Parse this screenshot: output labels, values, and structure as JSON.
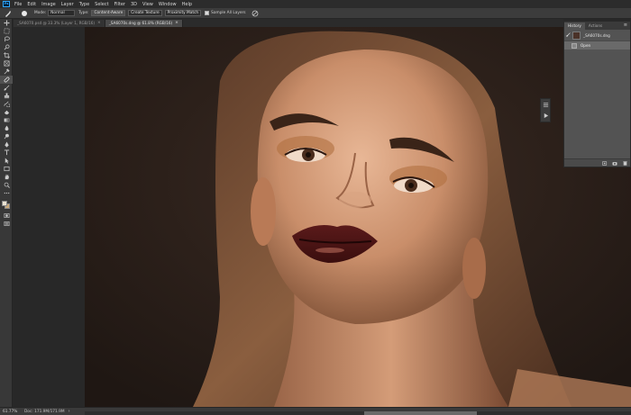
{
  "app": {
    "logo": "Ps"
  },
  "menu": [
    "File",
    "Edit",
    "Image",
    "Layer",
    "Type",
    "Select",
    "Filter",
    "3D",
    "View",
    "Window",
    "Help"
  ],
  "options": {
    "mode_label": "Mode:",
    "mode_value": "Normal",
    "type_label": "Type:",
    "btn_content_aware": "Content-Aware",
    "btn_create_texture": "Create Texture",
    "btn_proximity_match": "Proximity Match",
    "sample_all_layers": "Sample All Layers"
  },
  "tabs": [
    {
      "label": "_SA6070.psd @ 33.3% (Layer 1, RGB/16)",
      "close": "×"
    },
    {
      "label": "_SA6070s.dng @ 61.8% (RGB/16)",
      "close": "×"
    }
  ],
  "history": {
    "tab_history": "History",
    "tab_actions": "Actions",
    "menu": "≡",
    "snapshot_name": "_SA6070s.dng",
    "state_name": "Open"
  },
  "status": {
    "zoom": "61.77%",
    "doc": "Doc: 171.9M/171.9M",
    "arrow": "›"
  },
  "colors": {
    "foreground": "#eae3d3",
    "background": "#c9a879",
    "accent": "#31a8ff"
  }
}
